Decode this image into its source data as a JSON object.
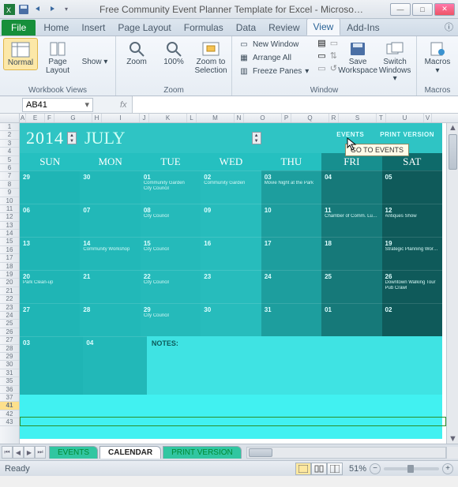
{
  "titlebar": {
    "title": "Free Community Event Planner Template for Excel - Microso…"
  },
  "ribbon_tabs": {
    "file": "File",
    "tabs": [
      "Home",
      "Insert",
      "Page Layout",
      "Formulas",
      "Data",
      "Review",
      "View",
      "Add-Ins"
    ],
    "active": "View"
  },
  "ribbon": {
    "workbook_views": {
      "label": "Workbook Views",
      "normal": "Normal",
      "page_layout": "Page\nLayout",
      "show": "Show"
    },
    "zoom": {
      "label": "Zoom",
      "zoom": "Zoom",
      "hundred": "100%",
      "to_sel": "Zoom to\nSelection"
    },
    "window": {
      "label": "Window",
      "new_window": "New Window",
      "arrange_all": "Arrange All",
      "freeze": "Freeze Panes",
      "save_ws": "Save\nWorkspace",
      "switch": "Switch\nWindows"
    },
    "macros": {
      "label": "Macros",
      "macros": "Macros"
    }
  },
  "formula_bar": {
    "name": "AB41",
    "fx": "fx"
  },
  "col_letters": [
    "A",
    "E",
    "F",
    "G",
    "H",
    "I",
    "J",
    "K",
    "L",
    "M",
    "N",
    "O",
    "P",
    "Q",
    "R",
    "S",
    "T",
    "U",
    "V"
  ],
  "row_nums": [
    "1",
    "2",
    "3",
    "4",
    "5",
    "6",
    "7",
    "8",
    "9",
    "10",
    "11",
    "12",
    "13",
    "14",
    "15",
    "16",
    "17",
    "18",
    "19",
    "20",
    "21",
    "22",
    "23",
    "24",
    "25",
    "26",
    "27",
    "28",
    "29",
    "30",
    "31",
    "35",
    "36",
    "37",
    "41",
    "42",
    "43"
  ],
  "calendar": {
    "year": "2014",
    "month": "JULY",
    "links": {
      "events": "EVENTS",
      "print": "PRINT VERSION"
    },
    "tooltip": "GO TO EVENTS",
    "dow": [
      "SUN",
      "MON",
      "TUE",
      "WED",
      "THU",
      "FRI",
      "SAT"
    ],
    "notes_label": "NOTES:",
    "weeks": [
      [
        {
          "n": "29",
          "ev": []
        },
        {
          "n": "30",
          "ev": []
        },
        {
          "n": "01",
          "ev": [
            "Community Garden",
            "City Council"
          ]
        },
        {
          "n": "02",
          "ev": [
            "Community Garden"
          ]
        },
        {
          "n": "03",
          "ev": [
            "Movie Night at the Park"
          ]
        },
        {
          "n": "04",
          "ev": []
        },
        {
          "n": "05",
          "ev": []
        }
      ],
      [
        {
          "n": "06",
          "ev": []
        },
        {
          "n": "07",
          "ev": []
        },
        {
          "n": "08",
          "ev": [
            "City Council"
          ]
        },
        {
          "n": "09",
          "ev": []
        },
        {
          "n": "10",
          "ev": []
        },
        {
          "n": "11",
          "ev": [
            "Chamber of Comm. Luncheon"
          ]
        },
        {
          "n": "12",
          "ev": [
            "Antiques Show"
          ]
        }
      ],
      [
        {
          "n": "13",
          "ev": []
        },
        {
          "n": "14",
          "ev": [
            "Community Workshop"
          ]
        },
        {
          "n": "15",
          "ev": [
            "City Council"
          ]
        },
        {
          "n": "16",
          "ev": []
        },
        {
          "n": "17",
          "ev": []
        },
        {
          "n": "18",
          "ev": []
        },
        {
          "n": "19",
          "ev": [
            "Strategic Planning Workshop"
          ]
        }
      ],
      [
        {
          "n": "20",
          "ev": [
            "Park Clean-up"
          ]
        },
        {
          "n": "21",
          "ev": []
        },
        {
          "n": "22",
          "ev": [
            "City Council"
          ]
        },
        {
          "n": "23",
          "ev": []
        },
        {
          "n": "24",
          "ev": []
        },
        {
          "n": "25",
          "ev": []
        },
        {
          "n": "26",
          "ev": [
            "Downtown Walking Tour",
            "Pub Crawl"
          ]
        }
      ],
      [
        {
          "n": "27",
          "ev": []
        },
        {
          "n": "28",
          "ev": []
        },
        {
          "n": "29",
          "ev": [
            "City Council"
          ]
        },
        {
          "n": "30",
          "ev": []
        },
        {
          "n": "31",
          "ev": []
        },
        {
          "n": "01",
          "ev": []
        },
        {
          "n": "02",
          "ev": []
        }
      ]
    ],
    "notes_days": [
      {
        "n": "03"
      },
      {
        "n": "04"
      }
    ]
  },
  "sheets": {
    "tabs": [
      "EVENTS",
      "CALENDAR",
      "PRINT VERSION"
    ],
    "active": "CALENDAR"
  },
  "status": {
    "ready": "Ready",
    "zoom": "51%"
  }
}
